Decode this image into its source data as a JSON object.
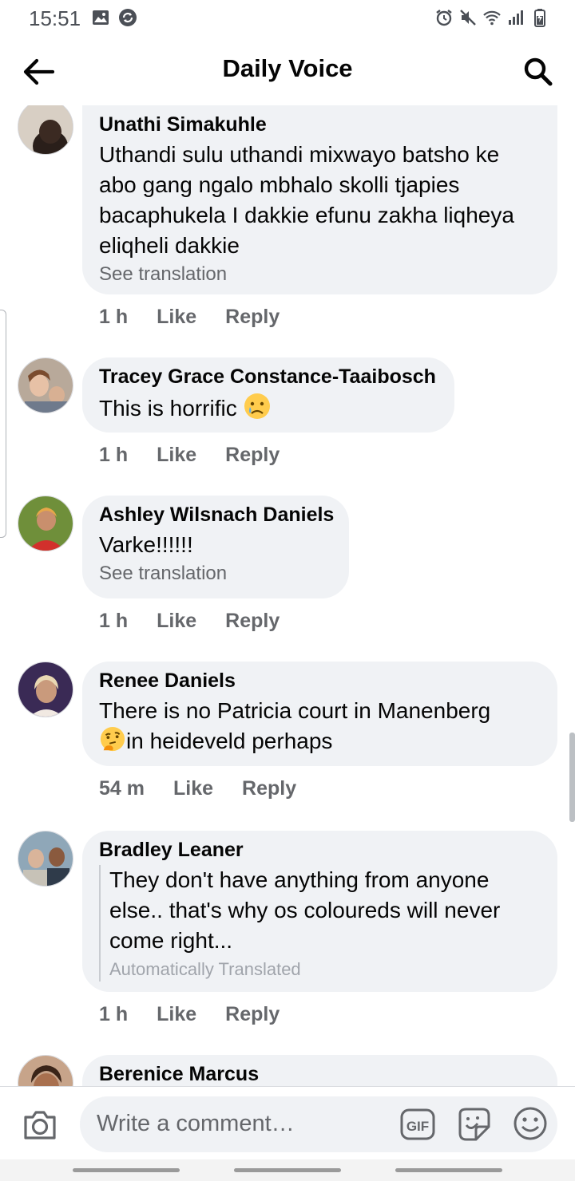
{
  "status_bar": {
    "time": "15:51",
    "left_icons": [
      "image-icon",
      "sync-icon"
    ],
    "right_icons": [
      "alarm-icon",
      "mute-icon",
      "wifi-icon",
      "signal-icon",
      "battery-icon"
    ]
  },
  "header": {
    "title": "Daily Voice",
    "back_icon": "arrow-left-icon",
    "search_icon": "search-icon"
  },
  "comments": [
    {
      "name": "Unathi Simakuhle",
      "text": "Uthandi sulu uthandi mixwayo batsho ke abo gang ngalo mbhalo skolli tjapies bacaphukela I dakkie efunu zakha liqheya eliqheli dakkie",
      "see_translation": "See translation",
      "time": "1 h",
      "like": "Like",
      "reply": "Reply"
    },
    {
      "name": "Tracey Grace Constance-Taaibosch",
      "text": "This is horrific",
      "emoji": "sad-tear-emoji",
      "time": "1 h",
      "like": "Like",
      "reply": "Reply"
    },
    {
      "name": "Ashley Wilsnach Daniels",
      "text": "Varke!!!!!!",
      "see_translation": "See translation",
      "time": "1 h",
      "like": "Like",
      "reply": "Reply"
    },
    {
      "name": "Renee Daniels",
      "text_line1": "There is no Patricia court in Manenberg",
      "text_line2": "in heideveld perhaps",
      "emoji": "thinking-emoji",
      "time": "54 m",
      "like": "Like",
      "reply": "Reply"
    },
    {
      "name": "Bradley Leaner",
      "text": "They don't have anything from anyone else.. that's why os coloureds will never come right...",
      "auto_translated": "Automatically Translated",
      "time": "1 h",
      "like": "Like",
      "reply": "Reply"
    },
    {
      "name": "Berenice Marcus"
    }
  ],
  "composer": {
    "placeholder": "Write a comment…",
    "camera_icon": "camera-icon",
    "gif_label": "GIF",
    "sticker_icon": "sticker-icon",
    "emoji_icon": "smiley-icon"
  },
  "colors": {
    "bubble": "#f0f2f5",
    "secondary_text": "#65676b",
    "primary_text": "#050505"
  }
}
